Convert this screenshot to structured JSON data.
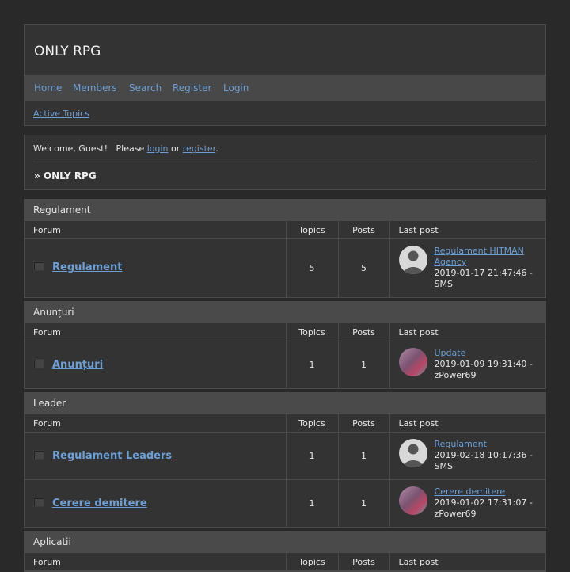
{
  "header": {
    "title": "ONLY RPG",
    "nav": [
      "Home",
      "Members",
      "Search",
      "Register",
      "Login"
    ],
    "active_topics": "Active Topics"
  },
  "welcome": {
    "prefix": "Welcome, Guest!   Please ",
    "login": "login",
    "or": " or ",
    "register": "register",
    "suffix": ".",
    "breadcrumb": "» ONLY RPG"
  },
  "columns": {
    "forum": "Forum",
    "topics": "Topics",
    "posts": "Posts",
    "last_post": "Last post"
  },
  "categories": [
    {
      "title": "Regulament",
      "forums": [
        {
          "name": "Regulament",
          "topics": "5",
          "posts": "5",
          "last_title": "Regulament HITMAN Agency",
          "last_meta": "2019-01-17 21:47:46 - SMS",
          "avatar": "default-avatar"
        }
      ]
    },
    {
      "title": "Anunțuri",
      "forums": [
        {
          "name": "Anunțuri",
          "topics": "1",
          "posts": "1",
          "last_title": "Update",
          "last_meta": "2019-01-09 19:31:40 - zPower69",
          "avatar": "user-avatar"
        }
      ]
    },
    {
      "title": "Leader",
      "forums": [
        {
          "name": "Regulament Leaders",
          "topics": "1",
          "posts": "1",
          "last_title": "Regulament",
          "last_meta": "2019-02-18 10:17:36 - SMS",
          "avatar": "default-avatar"
        },
        {
          "name": "Cerere demitere",
          "topics": "1",
          "posts": "1",
          "last_title": "Cerere demitere",
          "last_meta": "2019-01-02 17:31:07 - zPower69",
          "avatar": "user-avatar"
        }
      ]
    },
    {
      "title": "Aplicatii",
      "forums": []
    }
  ]
}
